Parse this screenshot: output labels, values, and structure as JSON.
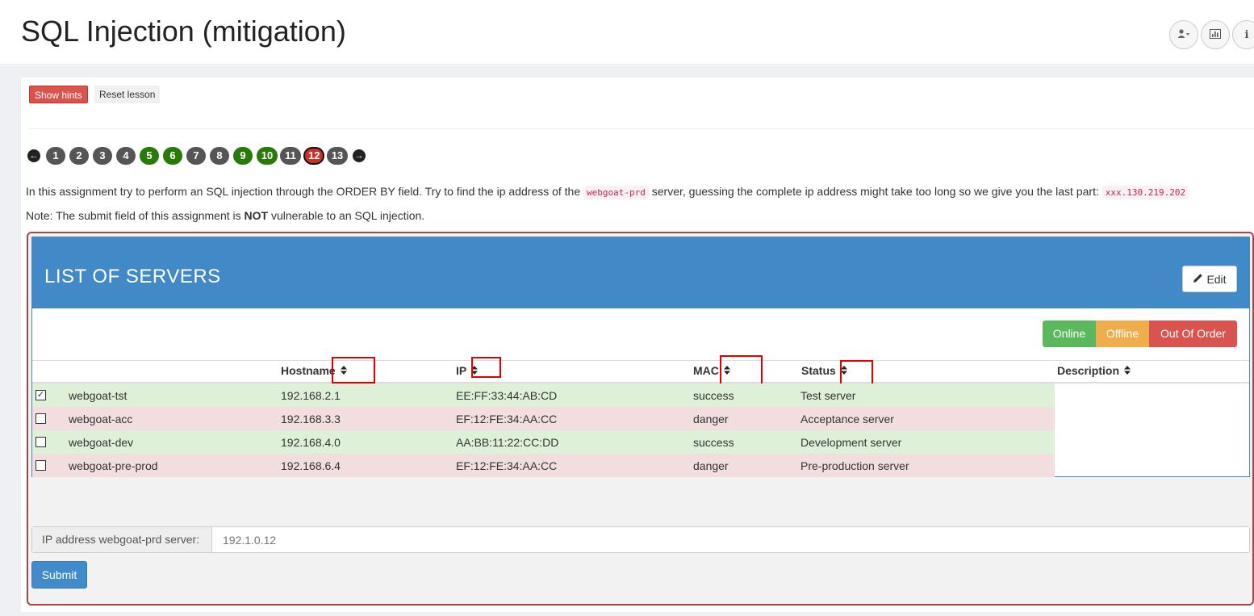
{
  "header": {
    "title": "SQL Injection (mitigation)",
    "icons": [
      "user-icon",
      "chart-icon",
      "info-icon"
    ]
  },
  "lesson": {
    "show_hints": "Show hints",
    "reset_lesson": "Reset lesson"
  },
  "pager": {
    "pages": [
      "1",
      "2",
      "3",
      "4",
      "5",
      "6",
      "7",
      "8",
      "9",
      "10",
      "11",
      "12",
      "13"
    ],
    "current": "12"
  },
  "description": {
    "line1_a": "In this assignment try to perform an SQL injection through the ORDER BY field. Try to find the ip address of the ",
    "code1": "webgoat-prd",
    "line1_b": " server, guessing the complete ip address might take too long so we give you the last part: ",
    "code2": "xxx.130.219.202",
    "line2_a": "Note: The submit field of this assignment is ",
    "line2_bold": "NOT",
    "line2_b": " vulnerable to an SQL injection."
  },
  "servers": {
    "title": "LIST OF SERVERS",
    "edit_label": "Edit",
    "status_buttons": {
      "online": "Online",
      "offline": "Offline",
      "out_of_order": "Out Of Order"
    },
    "columns": {
      "hostname": "Hostname",
      "ip": "IP",
      "mac": "MAC",
      "status": "Status",
      "description": "Description"
    },
    "rows": [
      {
        "hostname": "webgoat-tst",
        "ip": "192.168.2.1",
        "mac": "EE:FF:33:44:AB:CD",
        "status": "success",
        "description": "Test server",
        "checked": true
      },
      {
        "hostname": "webgoat-acc",
        "ip": "192.168.3.3",
        "mac": "EF:12:FE:34:AA:CC",
        "status": "danger",
        "description": "Acceptance server",
        "checked": false
      },
      {
        "hostname": "webgoat-dev",
        "ip": "192.168.4.0",
        "mac": "AA:BB:11:22:CC:DD",
        "status": "success",
        "description": "Development server",
        "checked": false
      },
      {
        "hostname": "webgoat-pre-prod",
        "ip": "192.168.6.4",
        "mac": "EF:12:FE:34:AA:CC",
        "status": "danger",
        "description": "Pre-production server",
        "checked": false
      }
    ]
  },
  "form": {
    "label": "IP address webgoat-prd server:",
    "placeholder": "192.1.0.12",
    "submit": "Submit"
  },
  "colors": {
    "primary": "#428bca",
    "danger": "#d9534f",
    "success": "#5cb85c",
    "warning": "#f0ad4e",
    "page_green": "#2a7a0a"
  }
}
